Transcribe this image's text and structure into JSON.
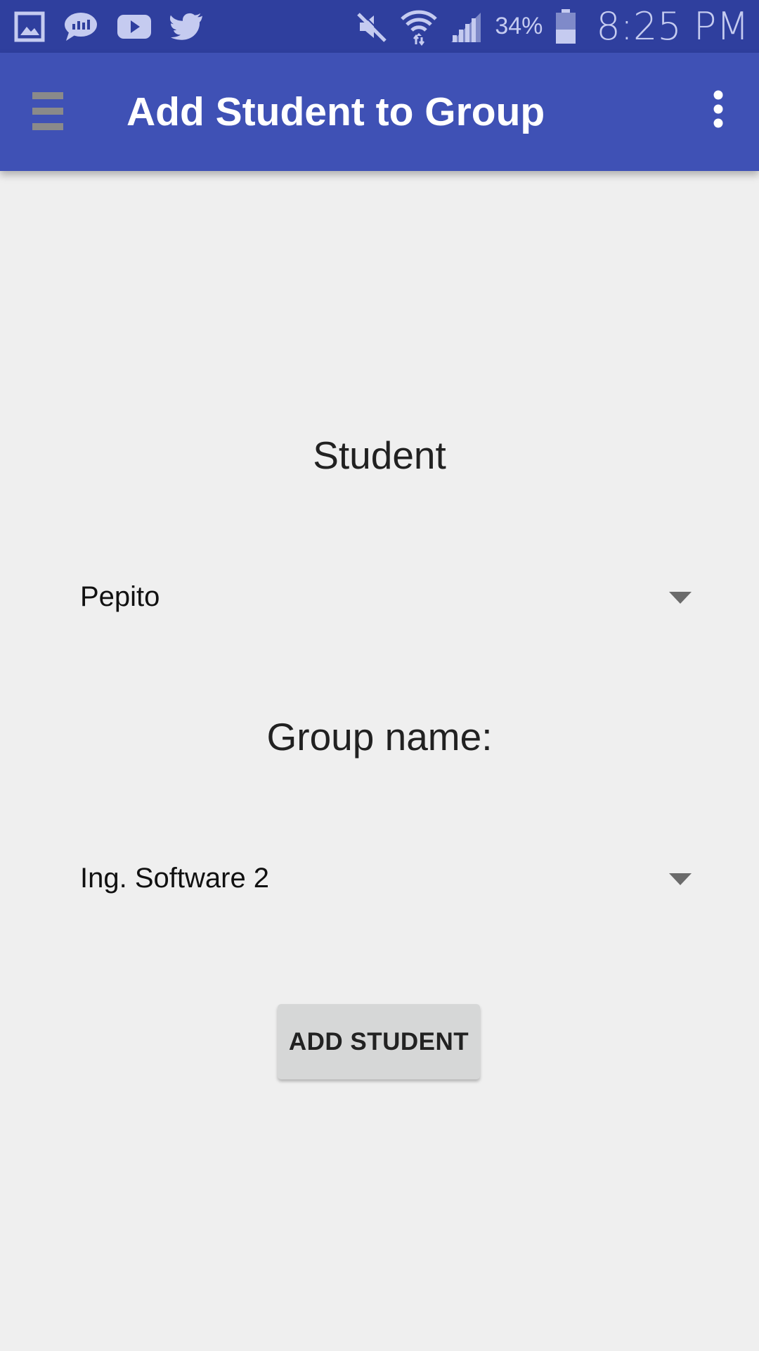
{
  "status_bar": {
    "notification_icons": [
      "gallery-icon",
      "messages-icon",
      "youtube-icon",
      "twitter-icon"
    ],
    "system_icons": [
      "mute-icon",
      "wifi-icon",
      "signal-icon",
      "battery-icon"
    ],
    "battery_percent": "34%",
    "time": "8:25 PM",
    "color": "#2f3f9e"
  },
  "app_bar": {
    "title": "Add Student to Group",
    "color": "#3f51b5",
    "menu_icon": "hamburger-menu-icon",
    "overflow_icon": "more-vert-icon"
  },
  "form": {
    "student_label": "Student",
    "student_selected": "Pepito",
    "group_label": "Group name:",
    "group_selected": "Ing. Software 2",
    "submit_label": "ADD STUDENT"
  },
  "colors": {
    "background": "#efefef",
    "button": "#d6d7d7"
  }
}
